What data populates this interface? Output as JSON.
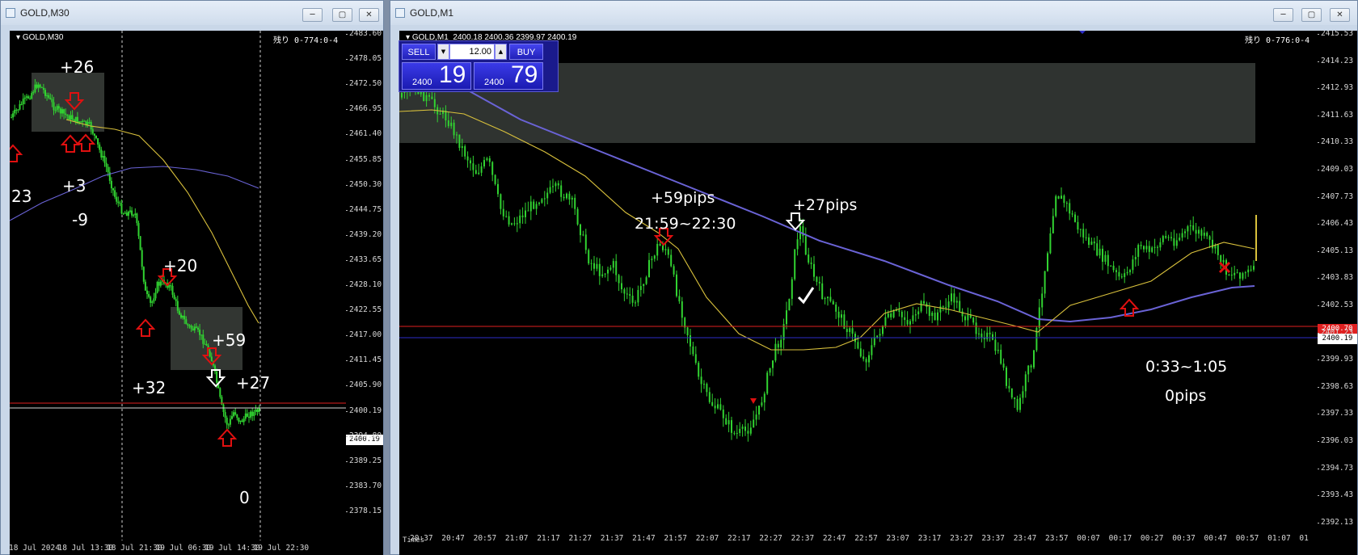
{
  "left_window": {
    "title": "GOLD,M30",
    "chart_symbol": "GOLD,M30",
    "countdown": "残り 0-774:0-4",
    "current_price_tag": "2400.19",
    "y_axis_labels": [
      "2483.60",
      "2478.05",
      "2472.50",
      "2466.95",
      "2461.40",
      "2455.85",
      "2450.30",
      "2444.75",
      "2439.20",
      "2433.65",
      "2428.10",
      "2422.55",
      "2417.00",
      "2411.45",
      "2405.90",
      "2400.19",
      "2394.80",
      "2389.25",
      "2383.70",
      "2378.15"
    ],
    "x_axis_labels": [
      "18 Jul 2024",
      "18 Jul 13:30",
      "18 Jul 21:30",
      "19 Jul 06:30",
      "19 Jul 14:30",
      "19 Jul 22:30"
    ],
    "annotations": [
      "+26",
      "+3",
      "-9",
      "23",
      "+20",
      "+59",
      "+27",
      "+32",
      "0"
    ],
    "controls": {
      "minimize": "─",
      "maximize": "▢",
      "close": "✕"
    }
  },
  "right_window": {
    "title": "GOLD,M1",
    "chart_symbol": "GOLD,M1",
    "ohlc": "2400.18 2400.36 2399.97 2400.19",
    "countdown": "残り 0-776:0-4",
    "current_price_tag": "2400.19",
    "red_line_tag": "2400.70",
    "yellow_tag": "",
    "y_axis_labels": [
      "2415.53",
      "2414.23",
      "2412.93",
      "2411.63",
      "2410.33",
      "2409.03",
      "2407.73",
      "2406.43",
      "2405.13",
      "2403.83",
      "2402.53",
      "2401.23",
      "2399.93",
      "2398.63",
      "2397.33",
      "2396.03",
      "2394.73",
      "2393.43",
      "2392.13"
    ],
    "x_axis_labels": [
      "20:37",
      "20:47",
      "20:57",
      "21:07",
      "21:17",
      "21:27",
      "21:37",
      "21:47",
      "21:57",
      "22:07",
      "22:17",
      "22:27",
      "22:37",
      "22:47",
      "22:57",
      "23:07",
      "23:17",
      "23:27",
      "23:37",
      "23:47",
      "23:57",
      "00:07",
      "00:17",
      "00:27",
      "00:37",
      "00:47",
      "00:57",
      "01:07",
      "01"
    ],
    "x_axis_title": "Times",
    "annotations": {
      "a1": "+59pips",
      "a2": "21:59~22:30",
      "a3": "+27pips",
      "a4": "0:33~1:05",
      "a5": "0pips"
    },
    "one_click_panel": {
      "sell_label": "SELL",
      "buy_label": "BUY",
      "lot_value": "12.00",
      "sell_price_prefix": "2400",
      "sell_price_big": "19",
      "buy_price_prefix": "2400",
      "buy_price_big": "79"
    },
    "controls": {
      "minimize": "─",
      "maximize": "▢",
      "close": "✕"
    }
  },
  "colors": {
    "candles": "#31d331",
    "ma_fast": "#d9c13c",
    "ma_slow": "#6a63d6",
    "bid_line": "#e02020",
    "ask_line": "#2d2dc8",
    "arrow_red": "#e01010"
  }
}
